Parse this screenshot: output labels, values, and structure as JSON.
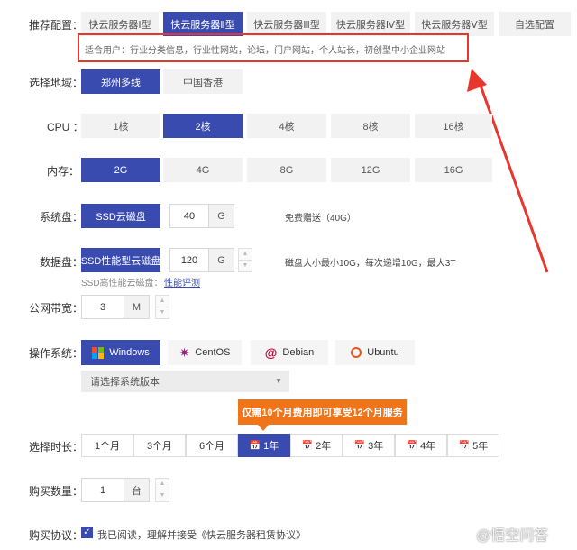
{
  "recommend": {
    "label": "推荐配置：",
    "options": [
      "快云服务器Ⅰ型",
      "快云服务器Ⅱ型",
      "快云服务器Ⅲ型",
      "快云服务器Ⅳ型",
      "快云服务器Ⅴ型",
      "自选配置"
    ],
    "selected_index": 1,
    "suitable": "适合用户：行业分类信息，行业性网站，论坛，门户网站，个人站长，初创型中小企业网站"
  },
  "region": {
    "label": "选择地域：",
    "options": [
      "郑州多线",
      "中国香港"
    ],
    "selected_index": 0
  },
  "cpu": {
    "label": "CPU ：",
    "options": [
      "1核",
      "2核",
      "4核",
      "8核",
      "16核"
    ],
    "selected_index": 1
  },
  "memory": {
    "label": "内存：",
    "options": [
      "2G",
      "4G",
      "8G",
      "12G",
      "16G"
    ],
    "selected_index": 0
  },
  "system_disk": {
    "label": "系统盘：",
    "type": "SSD云磁盘",
    "size": "40",
    "unit": "G",
    "note": "免费赠送（40G）"
  },
  "data_disk": {
    "label": "数据盘：",
    "type": "SSD性能型云磁盘",
    "size": "120",
    "unit": "G",
    "note": "磁盘大小最小10G，每次递增10G，最大3T",
    "sub_text": "SSD高性能云磁盘：",
    "sub_link": "性能评测"
  },
  "bandwidth": {
    "label": "公网带宽：",
    "value": "3",
    "unit": "M"
  },
  "os": {
    "label": "操作系统：",
    "options": [
      "Windows",
      "CentOS",
      "Debian",
      "Ubuntu"
    ],
    "selected_index": 0,
    "version_placeholder": "请选择系统版本"
  },
  "duration": {
    "label": "选择时长：",
    "promo": "仅需10个月费用即可享受12个月服务",
    "options": [
      "1个月",
      "3个月",
      "6个月",
      "1年",
      "2年",
      "3年",
      "4年",
      "5年"
    ],
    "selected_index": 3
  },
  "quantity": {
    "label": "购买数量：",
    "value": "1",
    "unit": "台"
  },
  "agreement": {
    "label": "购买协议：",
    "text": "我已阅读，理解并接受《快云服务器租赁协议》"
  },
  "watermark": "@悟空问答",
  "colors": {
    "accent": "#3a4bb0",
    "highlight": "#e8352d",
    "promo": "#f0741a"
  }
}
